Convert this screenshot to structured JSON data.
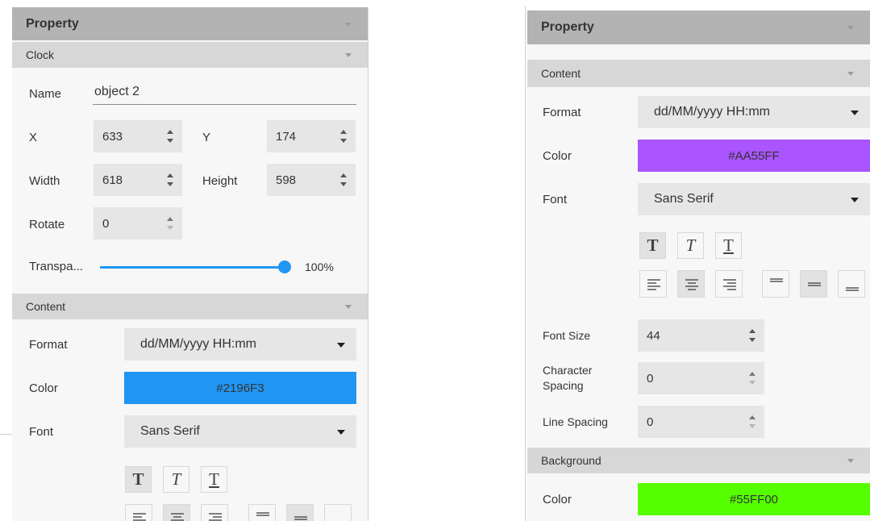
{
  "left": {
    "property_title": "Property",
    "clock_title": "Clock",
    "name_label": "Name",
    "name_value": "object 2",
    "x_label": "X",
    "x_value": "633",
    "y_label": "Y",
    "y_value": "174",
    "width_label": "Width",
    "width_value": "618",
    "height_label": "Height",
    "height_value": "598",
    "rotate_label": "Rotate",
    "rotate_value": "0",
    "transparency_label": "Transpa...",
    "transparency_text": "100%",
    "transparency_level": 1.0,
    "content_title": "Content",
    "format_label": "Format",
    "format_value": "dd/MM/yyyy HH:mm",
    "color_label": "Color",
    "color_value": "#2196F3",
    "font_label": "Font",
    "font_value": "Sans Serif"
  },
  "right": {
    "property_title": "Property",
    "content_title": "Content",
    "format_label": "Format",
    "format_value": "dd/MM/yyyy HH:mm",
    "color_label": "Color",
    "color_value": "#AA55FF",
    "font_label": "Font",
    "font_value": "Sans Serif",
    "font_size_label": "Font Size",
    "font_size_value": "44",
    "char_spacing_label": "Character Spacing",
    "char_spacing_value": "0",
    "line_spacing_label": "Line Spacing",
    "line_spacing_value": "0",
    "background_title": "Background",
    "bg_color_label": "Color",
    "bg_color_value": "#55FF00"
  },
  "text_style_buttons": {
    "bold_glyph": "T",
    "italic_glyph": "T",
    "underline_glyph": "T"
  },
  "icons": [
    "collapse-caret-icon",
    "spinner-arrows-icon",
    "dropdown-arrow-icon",
    "bold-icon",
    "italic-icon",
    "underline-icon",
    "align-left-icon",
    "align-center-icon",
    "align-right-icon",
    "align-top-icon",
    "align-middle-icon",
    "align-bottom-icon"
  ],
  "colors": {
    "accent": "#2196F3",
    "header_main": "#B3B3B3",
    "header_sub": "#D7D7D7",
    "panel_bg": "#F7F7F7",
    "input_bg": "#E6E6E6"
  }
}
